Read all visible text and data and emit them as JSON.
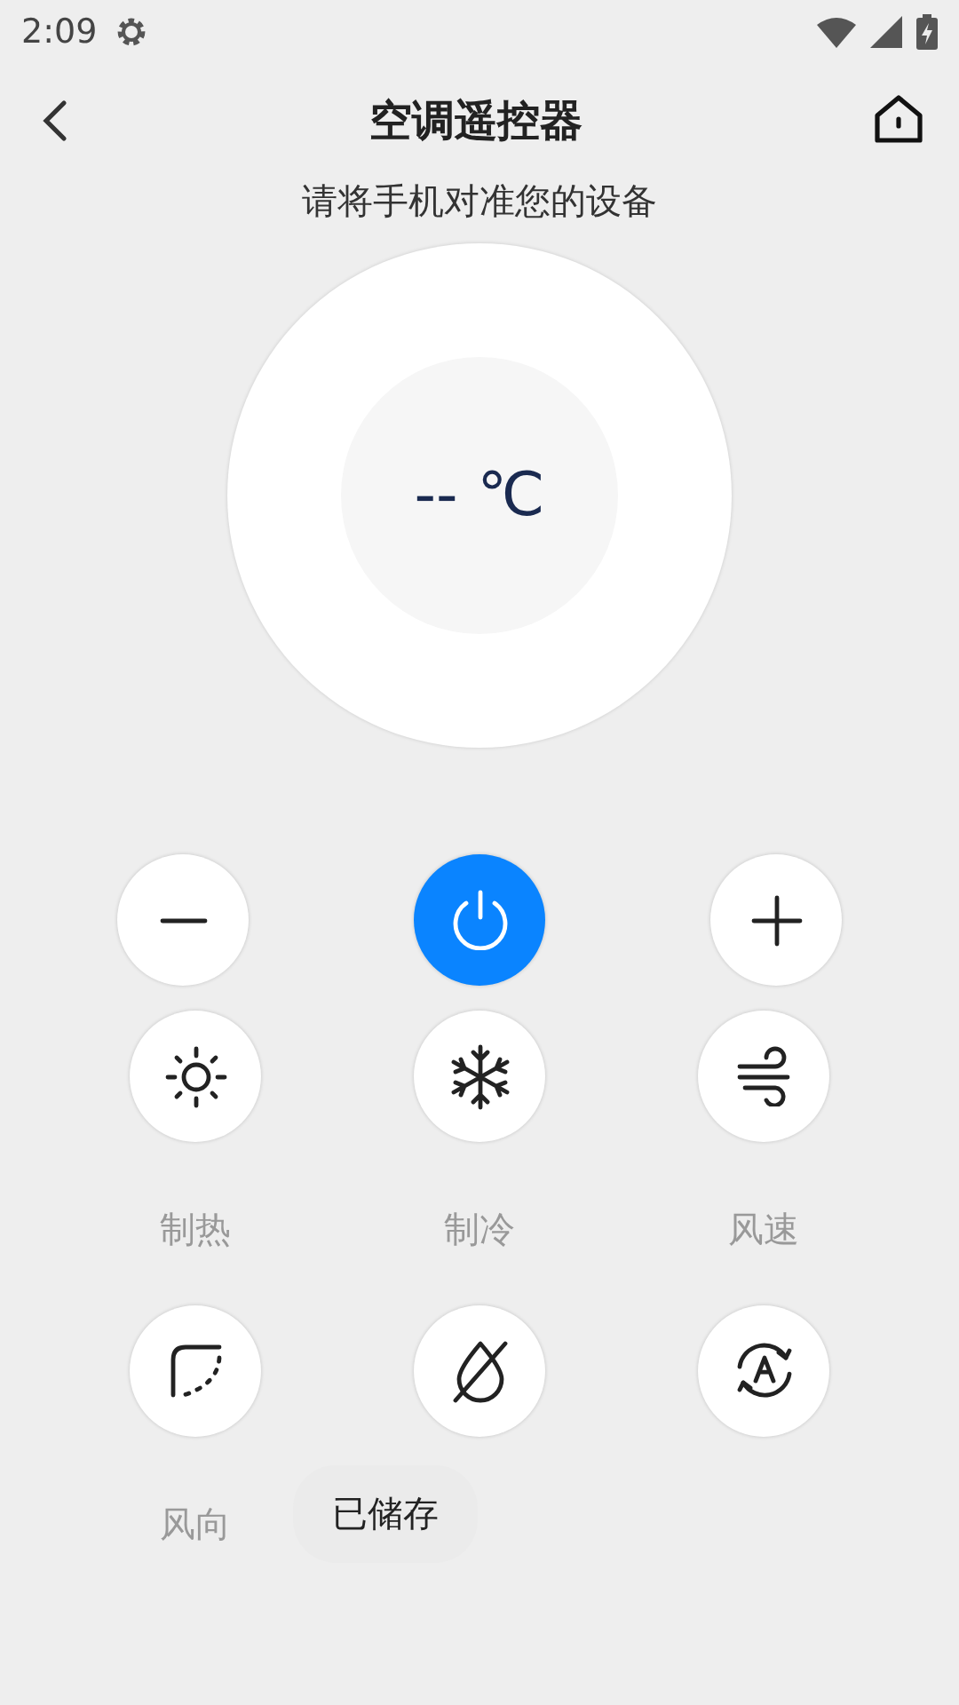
{
  "status_bar": {
    "time": "2:09"
  },
  "header": {
    "title": "空调遥控器",
    "hint": "请将手机对准您的设备"
  },
  "display": {
    "temperature": "-- ℃"
  },
  "top_buttons": [
    {
      "kind": "minus",
      "on": false
    },
    {
      "kind": "power",
      "on": true
    },
    {
      "kind": "plus",
      "on": false
    }
  ],
  "modes": [
    {
      "kind": "heat",
      "label": "制热"
    },
    {
      "kind": "cool",
      "label": "制冷"
    },
    {
      "kind": "fan",
      "label": "风速"
    },
    {
      "kind": "swing",
      "label": "风向"
    },
    {
      "kind": "dry"
    },
    {
      "kind": "auto"
    }
  ],
  "toast": {
    "text": "已储存"
  }
}
